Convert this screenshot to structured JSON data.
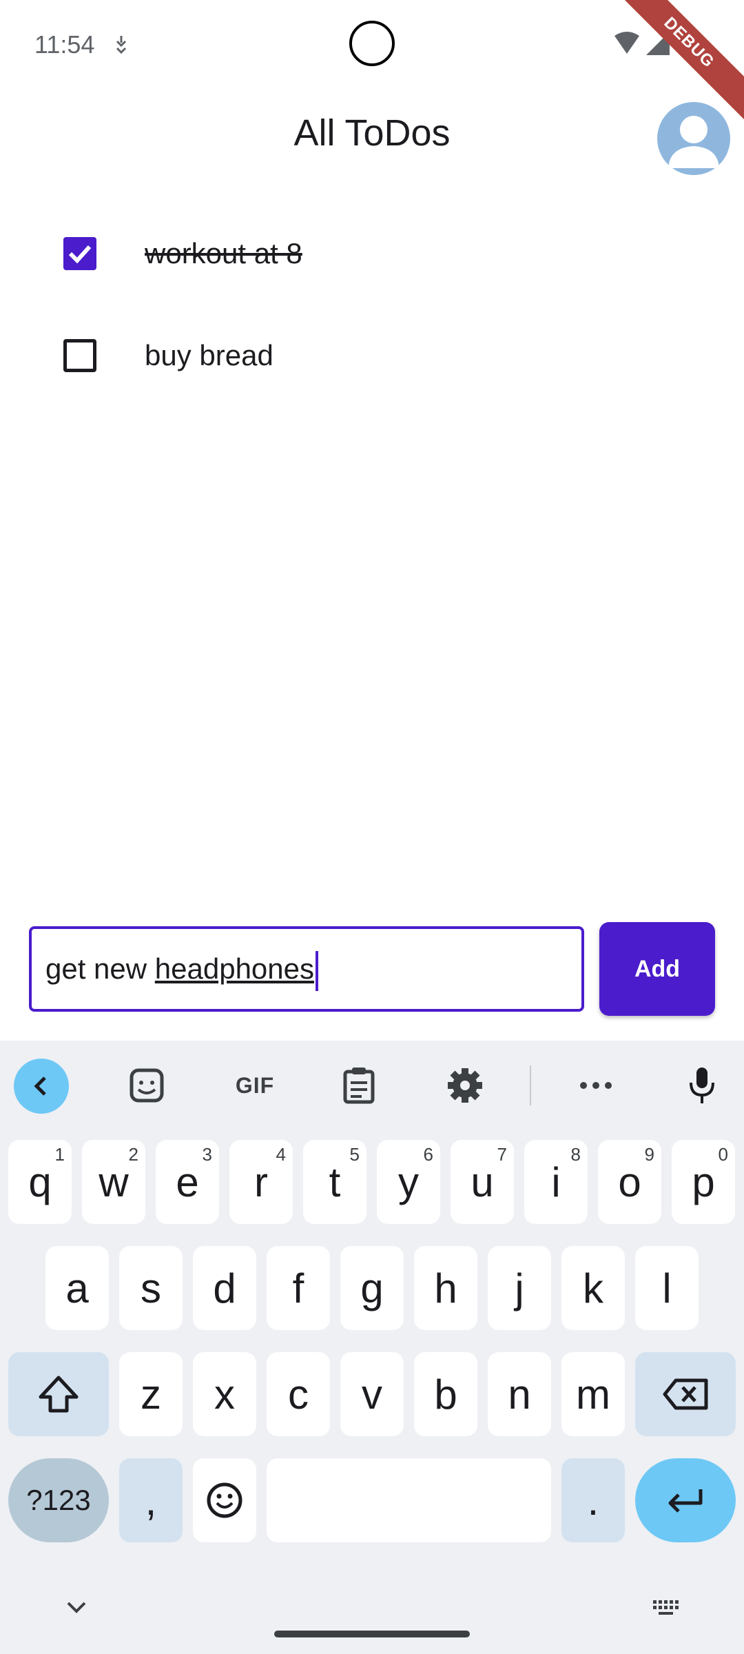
{
  "status_bar": {
    "time": "11:54",
    "debug_label": "DEBUG"
  },
  "app_bar": {
    "title": "All ToDos"
  },
  "todos": [
    {
      "text": "workout at 8",
      "done": true
    },
    {
      "text": "buy bread",
      "done": false
    }
  ],
  "new_todo": {
    "value_prefix": "get new ",
    "value_underlined": "headphones",
    "add_label": "Add"
  },
  "keyboard": {
    "toolbar": {
      "gif_label": "GIF",
      "icons": [
        "back-icon",
        "sticker-icon",
        "gif-icon",
        "clipboard-icon",
        "settings-icon",
        "more-icon",
        "mic-icon"
      ]
    },
    "row1": [
      {
        "key": "q",
        "hint": "1"
      },
      {
        "key": "w",
        "hint": "2"
      },
      {
        "key": "e",
        "hint": "3"
      },
      {
        "key": "r",
        "hint": "4"
      },
      {
        "key": "t",
        "hint": "5"
      },
      {
        "key": "y",
        "hint": "6"
      },
      {
        "key": "u",
        "hint": "7"
      },
      {
        "key": "i",
        "hint": "8"
      },
      {
        "key": "o",
        "hint": "9"
      },
      {
        "key": "p",
        "hint": "0"
      }
    ],
    "row2": [
      "a",
      "s",
      "d",
      "f",
      "g",
      "h",
      "j",
      "k",
      "l"
    ],
    "row3": [
      "z",
      "x",
      "c",
      "v",
      "b",
      "n",
      "m"
    ],
    "row4": {
      "symbols": "?123",
      "comma": ",",
      "period": "."
    }
  },
  "colors": {
    "primary": "#4a1ccc",
    "keyboard_bg": "#eef0f4",
    "key_accent": "#6ec8f5",
    "debug_banner": "#b0433e"
  }
}
